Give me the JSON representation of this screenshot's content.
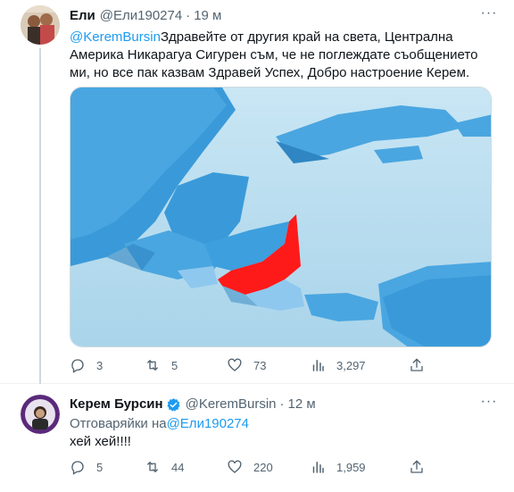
{
  "tweet1": {
    "author_name": "Ели",
    "author_handle": "@Ели190274",
    "dot": "·",
    "time": "19 м",
    "more_label": "···",
    "mention": "@KeremBursin",
    "text": "Здравейте от другия край на света, Централна Америка Никарагуа Сигурен съм, че не поглеждате съобщението ми, но все пак казвам Здравей Успех, Добро настроение Керем.",
    "media_icon": "map-central-america-nicaragua-highlighted",
    "actions": {
      "replies": "3",
      "retweets": "5",
      "likes": "73",
      "views": "3,297"
    }
  },
  "tweet2": {
    "author_name": "Керем Бурсин",
    "author_handle": "@KeremBursin",
    "dot": "·",
    "time": "12 м",
    "more_label": "···",
    "reply_prefix": "Отговаряйки на",
    "reply_handle": "@Ели190274",
    "text": "хей хей!!!!",
    "actions": {
      "replies": "5",
      "retweets": "44",
      "likes": "220",
      "views": "1,959"
    }
  },
  "colors": {
    "accent": "#1d9bf0",
    "muted": "#536471",
    "highlight": "#ff1a1a"
  }
}
